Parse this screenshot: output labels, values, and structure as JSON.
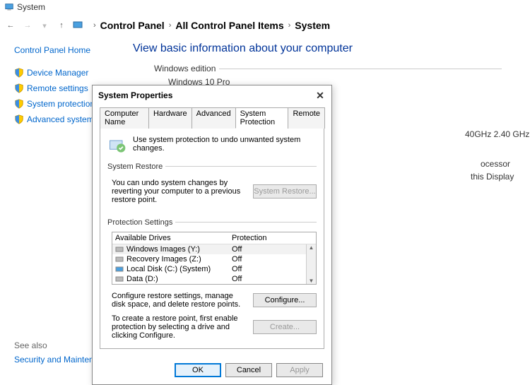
{
  "window": {
    "title": "System"
  },
  "breadcrumb": [
    "Control Panel",
    "All Control Panel Items",
    "System"
  ],
  "sidebar": {
    "home": "Control Panel Home",
    "links": [
      "Device Manager",
      "Remote settings",
      "System protection",
      "Advanced system settings"
    ]
  },
  "content": {
    "heading": "View basic information about your computer",
    "edition_label": "Windows edition",
    "edition_partial": "Windows 10 Pro",
    "spec_cpu_partial": "40GHz  2.40 GHz",
    "spec_proc_partial": "ocessor",
    "spec_display_partial": "this Display"
  },
  "see_also": {
    "header": "See also",
    "link": "Security and Maintenance"
  },
  "dialog": {
    "title": "System Properties",
    "tabs": [
      "Computer Name",
      "Hardware",
      "Advanced",
      "System Protection",
      "Remote"
    ],
    "active_tab": 3,
    "info": "Use system protection to undo unwanted system changes.",
    "restore": {
      "label": "System Restore",
      "text": "You can undo system changes by reverting your computer to a previous restore point.",
      "button": "System Restore..."
    },
    "protection": {
      "label": "Protection Settings",
      "col1": "Available Drives",
      "col2": "Protection",
      "drives": [
        {
          "name": "Windows Images (Y:)",
          "status": "Off",
          "icon": "hdd"
        },
        {
          "name": "Recovery Images (Z:)",
          "status": "Off",
          "icon": "hdd"
        },
        {
          "name": "Local Disk (C:) (System)",
          "status": "Off",
          "icon": "hdd-sys"
        },
        {
          "name": "Data (D:)",
          "status": "Off",
          "icon": "hdd"
        }
      ],
      "configure_text": "Configure restore settings, manage disk space, and delete restore points.",
      "configure_btn": "Configure...",
      "create_text": "To create a restore point, first enable protection by selecting a drive and clicking Configure.",
      "create_btn": "Create..."
    },
    "buttons": {
      "ok": "OK",
      "cancel": "Cancel",
      "apply": "Apply"
    }
  }
}
